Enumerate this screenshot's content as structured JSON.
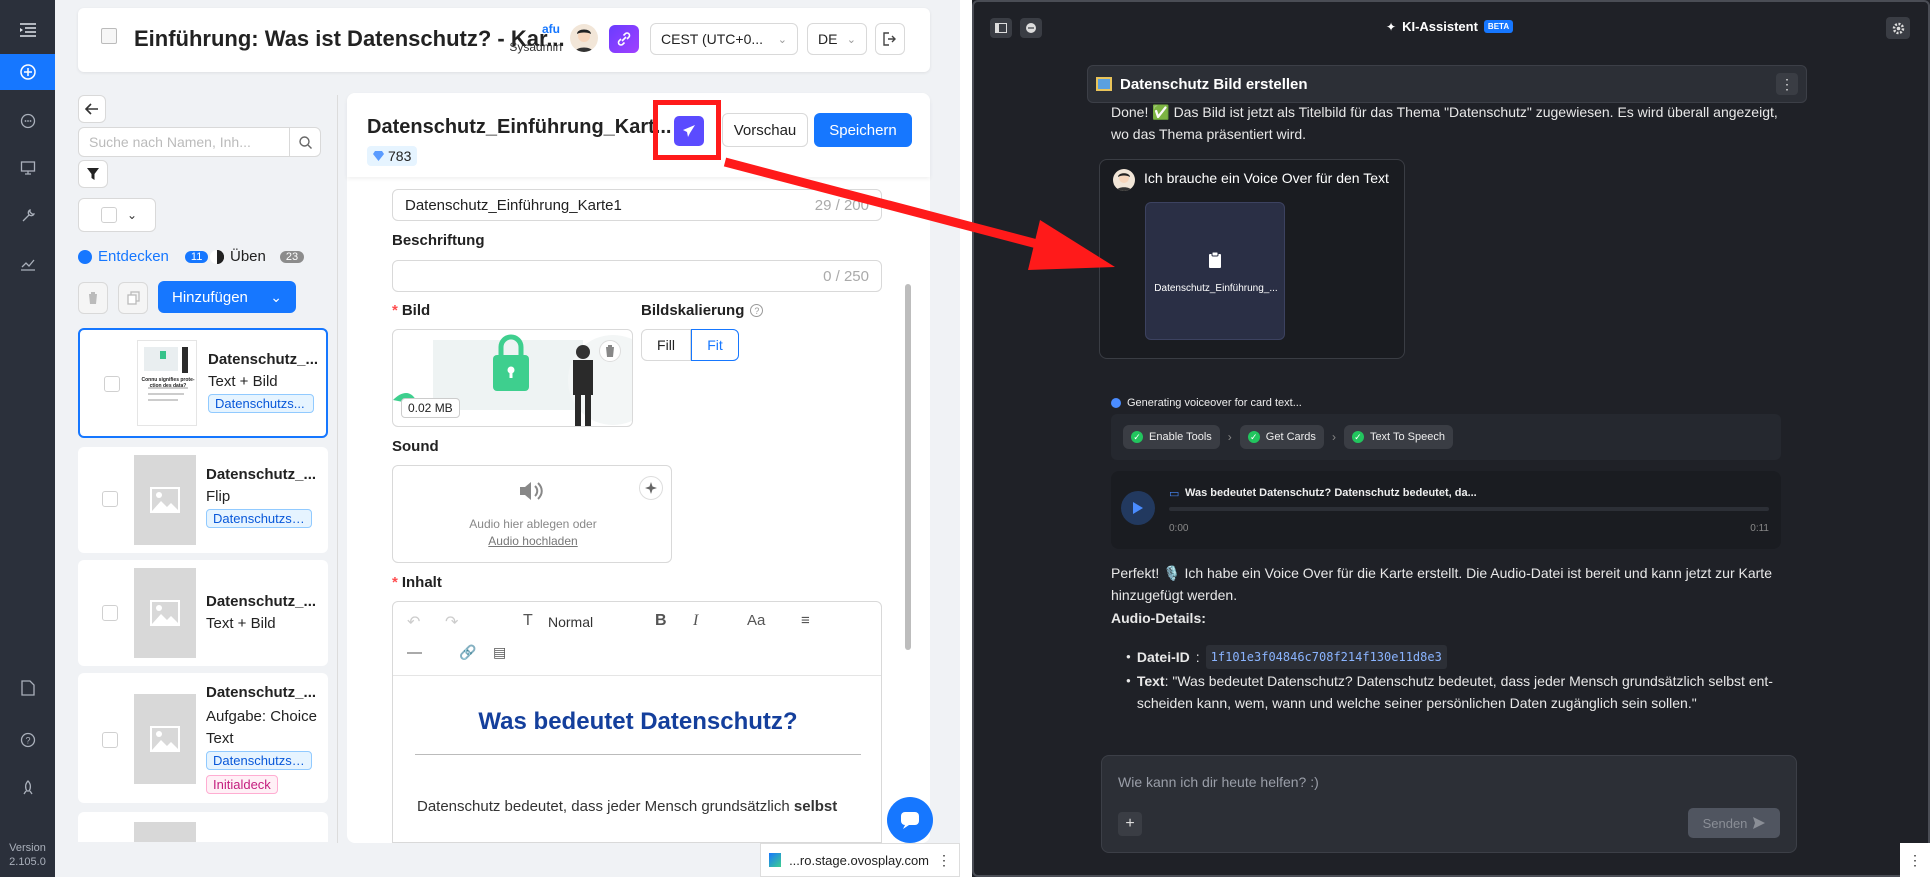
{
  "header": {
    "title": "Einführung: Was ist Datenschutz? - Kar...",
    "user_name": "afu",
    "user_role": "Sysadmin",
    "timezone": "CEST (UTC+0...",
    "language": "DE"
  },
  "sidebar_rail": {
    "version_label": "Version",
    "version": "2.105.0"
  },
  "card_list": {
    "search_placeholder": "Suche nach Namen, Inh...",
    "tab_discover": "Entdecken",
    "tab_discover_count": "11",
    "tab_practice": "Üben",
    "tab_practice_count": "23",
    "add_button": "Hinzufügen",
    "items": [
      {
        "title": "Datenschutz_...",
        "type": "Text + Bild",
        "tags": [
          "Datenschutzs..."
        ]
      },
      {
        "title": "Datenschutz_...",
        "type": "Flip",
        "tags": [
          "Datenschutzsa..."
        ]
      },
      {
        "title": "Datenschutz_...",
        "type": "Text + Bild",
        "tags": []
      },
      {
        "title": "Datenschutz_...",
        "type": "Aufgabe: Choice Text",
        "tags": [
          "Datenschutzsa...",
          "Initialdeck"
        ]
      }
    ],
    "thumb_caption": "Connu signifies prote-ction des data?"
  },
  "editor": {
    "card_title": "Datenschutz_Einführung_Kart...",
    "diamonds": "783",
    "preview_button": "Vorschau",
    "save_button": "Speichern",
    "name_value": "Datenschutz_Einführung_Karte1",
    "name_counter": "29 / 200",
    "caption_label": "Beschriftung",
    "caption_counter": "0 / 250",
    "image_label": "Bild",
    "image_size": "0.02 MB",
    "scaling_label": "Bildskalierung",
    "scaling_fill": "Fill",
    "scaling_fit": "Fit",
    "sound_label": "Sound",
    "sound_drop_text": "Audio hier ablegen oder",
    "sound_upload_link": "Audio hochladen",
    "content_label": "Inhalt",
    "toolbar_style": "Normal",
    "content_heading": "Was bedeutet Datenschutz?",
    "content_body": "Datenschutz bedeutet, dass jeder Mensch grundsätzlich",
    "content_body_bold": "selbst"
  },
  "browser": {
    "url_fragment": "...ro.stage.ovosplay.com"
  },
  "assistant": {
    "title": "KI-Assistent",
    "beta": "BETA",
    "pinned_task": "Datenschutz Bild erstellen",
    "done_message": "Done! ✅ Das Bild ist jetzt als Titelbild für das Thema \"Datenschutz\" zugewiesen. Es wird überall angezeigt, wo das Thema präsentiert wird.",
    "user_message": "Ich brauche ein Voice Over für den Text",
    "attachment_name": "Datenschutz_Einführung_...",
    "generating_label": "Generating voiceover for card text...",
    "steps": [
      "Enable Tools",
      "Get Cards",
      "Text To Speech"
    ],
    "audio_title": "Was bedeutet Datenschutz? Datenschutz bedeutet, da...",
    "audio_start": "0:00",
    "audio_end": "0:11",
    "reply_line1": "Perfekt! 🎙️ Ich habe ein Voice Over für die Karte erstellt. Die Audio-Datei ist bereit und kann jetzt zur Karte hinzugefügt werden.",
    "audio_details_label": "Audio-Details:",
    "file_id_label": "Datei-ID",
    "file_id": "1f101e3f04846c708f214f130e11d8e3",
    "text_label": "Text",
    "text_value": ": \"Was bedeutet Datenschutz? Datenschutz bedeutet, dass jeder Mensch grundsätzlich selbst ent-scheiden kann, wem, wann und welche seiner persönlichen Daten zugänglich sein sollen.\"",
    "input_placeholder": "Wie kann ich dir heute helfen? :)",
    "send_button": "Senden"
  },
  "colors": {
    "primary": "#1677ff",
    "rail_bg": "#2b303b",
    "dark_panel": "#1f2127",
    "annotation_red": "#ff1a1a",
    "send_accent": "#5b4bff"
  }
}
